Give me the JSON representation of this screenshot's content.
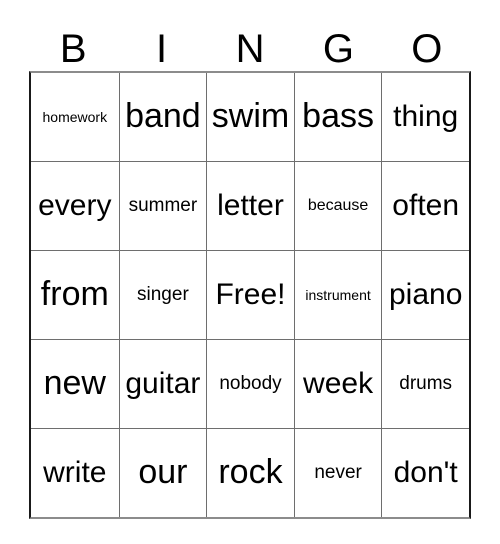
{
  "card": {
    "header_letters": [
      "B",
      "I",
      "N",
      "G",
      "O"
    ],
    "rows": [
      [
        {
          "text": "homework",
          "size": "xs"
        },
        {
          "text": "band",
          "size": "xl"
        },
        {
          "text": "swim",
          "size": "xl"
        },
        {
          "text": "bass",
          "size": "xl"
        },
        {
          "text": "thing",
          "size": "lg"
        }
      ],
      [
        {
          "text": "every",
          "size": "lg"
        },
        {
          "text": "summer",
          "size": "md"
        },
        {
          "text": "letter",
          "size": "lg"
        },
        {
          "text": "because",
          "size": "sm"
        },
        {
          "text": "often",
          "size": "lg"
        }
      ],
      [
        {
          "text": "from",
          "size": "xl"
        },
        {
          "text": "singer",
          "size": "md"
        },
        {
          "text": "Free!",
          "size": "lg"
        },
        {
          "text": "instrument",
          "size": "xs"
        },
        {
          "text": "piano",
          "size": "lg"
        }
      ],
      [
        {
          "text": "new",
          "size": "xl"
        },
        {
          "text": "guitar",
          "size": "lg"
        },
        {
          "text": "nobody",
          "size": "md"
        },
        {
          "text": "week",
          "size": "lg"
        },
        {
          "text": "drums",
          "size": "md"
        }
      ],
      [
        {
          "text": "write",
          "size": "lg"
        },
        {
          "text": "our",
          "size": "xl"
        },
        {
          "text": "rock",
          "size": "xl"
        },
        {
          "text": "never",
          "size": "md"
        },
        {
          "text": "don't",
          "size": "lg"
        }
      ]
    ]
  },
  "colors": {
    "background": "#ffffff",
    "text": "#000000",
    "grid_line": "#6e6e6e",
    "outer_border": "#1a1a1a"
  }
}
